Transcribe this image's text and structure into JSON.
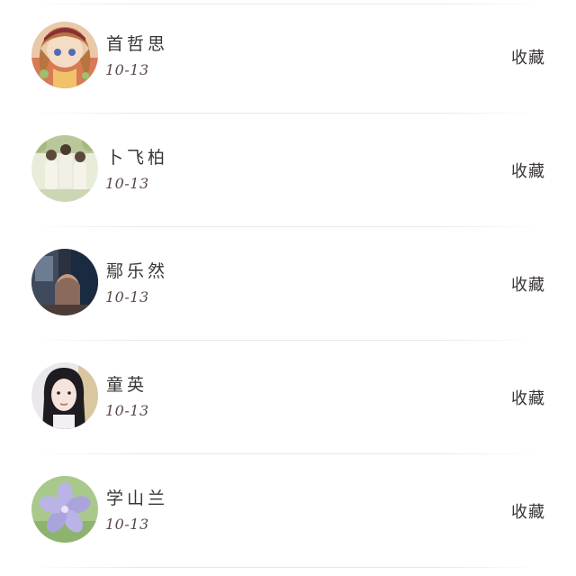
{
  "list": {
    "items": [
      {
        "name": "首哲思",
        "date": "10-13",
        "action": "收藏",
        "avatar": "anime-girl-avatar"
      },
      {
        "name": "卜飞柏",
        "date": "10-13",
        "action": "收藏",
        "avatar": "group-photo-avatar"
      },
      {
        "name": "鄢乐然",
        "date": "10-13",
        "action": "收藏",
        "avatar": "dark-room-avatar"
      },
      {
        "name": "童英",
        "date": "10-13",
        "action": "收藏",
        "avatar": "woman-portrait-avatar"
      },
      {
        "name": "学山兰",
        "date": "10-13",
        "action": "收藏",
        "avatar": "purple-flower-avatar"
      }
    ]
  }
}
